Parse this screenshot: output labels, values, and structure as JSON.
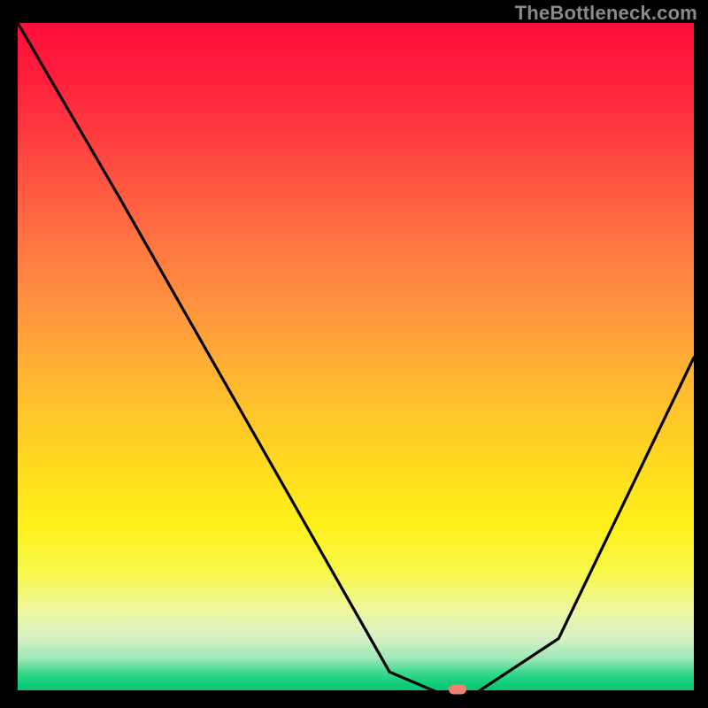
{
  "watermark": "TheBottleneck.com",
  "colors": {
    "frame_bg": "#000000",
    "watermark_text": "#8a8a8d",
    "curve_stroke": "#000000",
    "marker_fill": "#f08171",
    "gradient_top": "#ff0e3a",
    "gradient_bottom": "#08c574"
  },
  "chart_data": {
    "type": "line",
    "title": "",
    "xlabel": "",
    "ylabel": "",
    "xlim": [
      0,
      100
    ],
    "ylim": [
      0,
      100
    ],
    "x": [
      0,
      15,
      55,
      62,
      68,
      80,
      100
    ],
    "values": [
      100,
      74,
      3,
      0,
      0,
      8,
      50
    ],
    "marker": {
      "x": 65,
      "y": 0
    },
    "annotations": []
  }
}
